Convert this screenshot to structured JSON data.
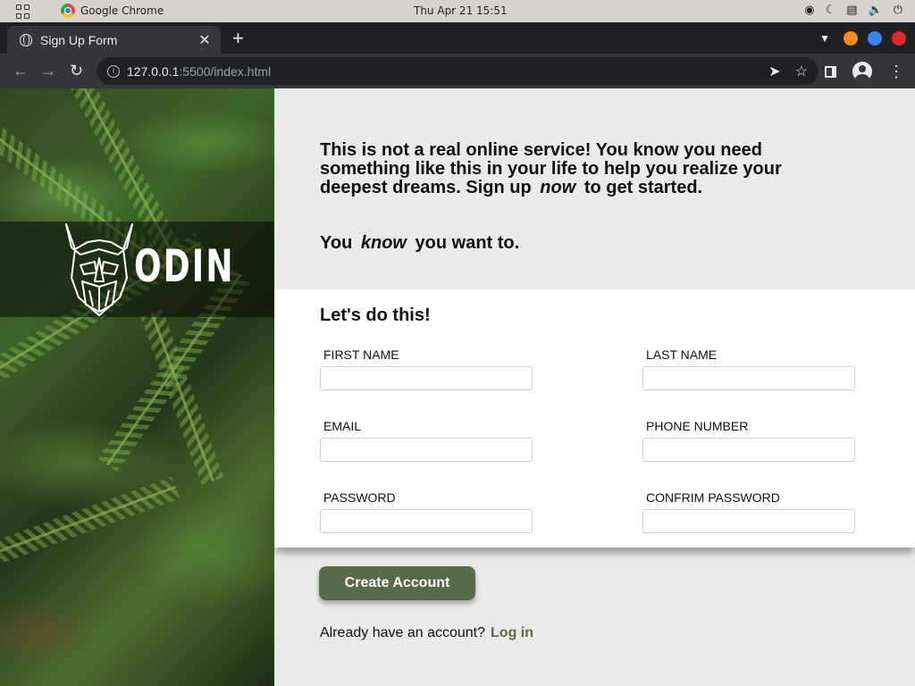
{
  "system": {
    "app_name": "Google Chrome",
    "clock": "Thu Apr 21  15:51"
  },
  "browser": {
    "tab_title": "Sign Up Form",
    "url_host": "127.0.0.1",
    "url_path": ":5500/index.html"
  },
  "sidebar": {
    "logo_text": "ODIN"
  },
  "hero": {
    "line_part1": "This is not a real online service! You know you need something like this in your life to help you realize your deepest dreams. Sign up",
    "line_emph": "now",
    "line_part2": "to get started.",
    "tagline_part1": "You",
    "tagline_emph": "know",
    "tagline_part2": "you want to."
  },
  "form": {
    "heading": "Let's do this!",
    "fields": [
      {
        "label": "FIRST NAME",
        "value": ""
      },
      {
        "label": "LAST NAME",
        "value": ""
      },
      {
        "label": "EMAIL",
        "value": ""
      },
      {
        "label": "PHONE NUMBER",
        "value": ""
      },
      {
        "label": "PASSWORD",
        "value": ""
      },
      {
        "label": "CONFRIM PASSWORD",
        "value": ""
      }
    ],
    "submit_label": "Create Account",
    "login_prompt": "Already have an account?",
    "login_link": "Log in"
  },
  "colors": {
    "accent": "#596a48",
    "chrome_dark": "#202124",
    "chrome_toolbar": "#35363a"
  }
}
